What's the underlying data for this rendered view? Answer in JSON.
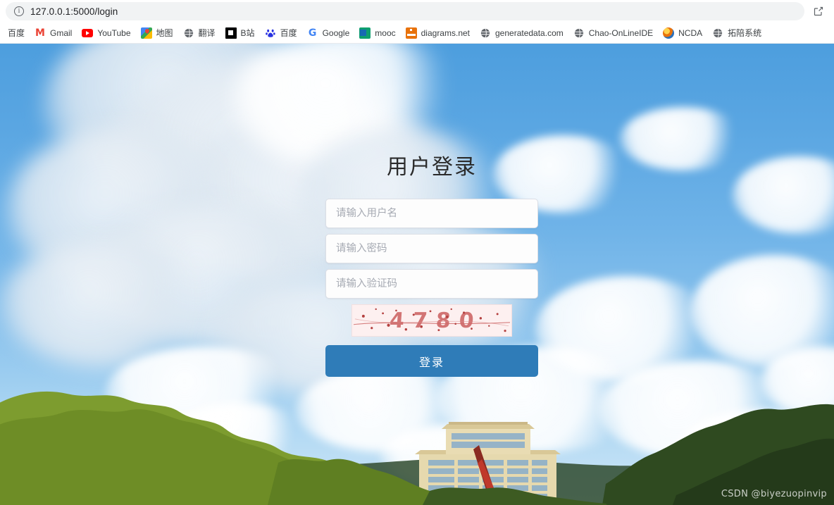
{
  "browser": {
    "url": "127.0.0.1:5000/login",
    "info_icon": "info-circle-icon",
    "share_icon": "share-icon",
    "bookmarks": [
      {
        "label": "百度",
        "icon": "none"
      },
      {
        "label": "Gmail",
        "icon": "gmail-icon"
      },
      {
        "label": "YouTube",
        "icon": "youtube-icon"
      },
      {
        "label": "地图",
        "icon": "google-maps-icon"
      },
      {
        "label": "翻译",
        "icon": "globe-icon"
      },
      {
        "label": "B站",
        "icon": "black-square-icon"
      },
      {
        "label": "百度",
        "icon": "baidu-paw-icon"
      },
      {
        "label": "Google",
        "icon": "google-g-icon"
      },
      {
        "label": "mooc",
        "icon": "mooc-icon"
      },
      {
        "label": "diagrams.net",
        "icon": "diagrams-net-icon"
      },
      {
        "label": "generatedata.com",
        "icon": "globe-icon"
      },
      {
        "label": "Chao-OnLineIDE",
        "icon": "globe-icon"
      },
      {
        "label": "NCDA",
        "icon": "ncda-icon"
      },
      {
        "label": "拓陪系统",
        "icon": "globe-icon"
      }
    ]
  },
  "login": {
    "title": "用户登录",
    "username": {
      "value": "",
      "placeholder": "请输入用户名"
    },
    "password": {
      "value": "",
      "placeholder": "请输入密码"
    },
    "captcha_input": {
      "value": "",
      "placeholder": "请输入验证码"
    },
    "captcha_code": "4780",
    "submit_label": "登录"
  },
  "colors": {
    "button": "#2f7cb8",
    "title_text": "#2b2b2b",
    "placeholder": "#a6aab3",
    "captcha_text": "#cf6a6a",
    "captcha_bg": "#fdf0f0",
    "sky_top": "#4d9ede",
    "sky_bottom": "#cfe7f7"
  },
  "watermark": "CSDN @biyezuopinvip"
}
